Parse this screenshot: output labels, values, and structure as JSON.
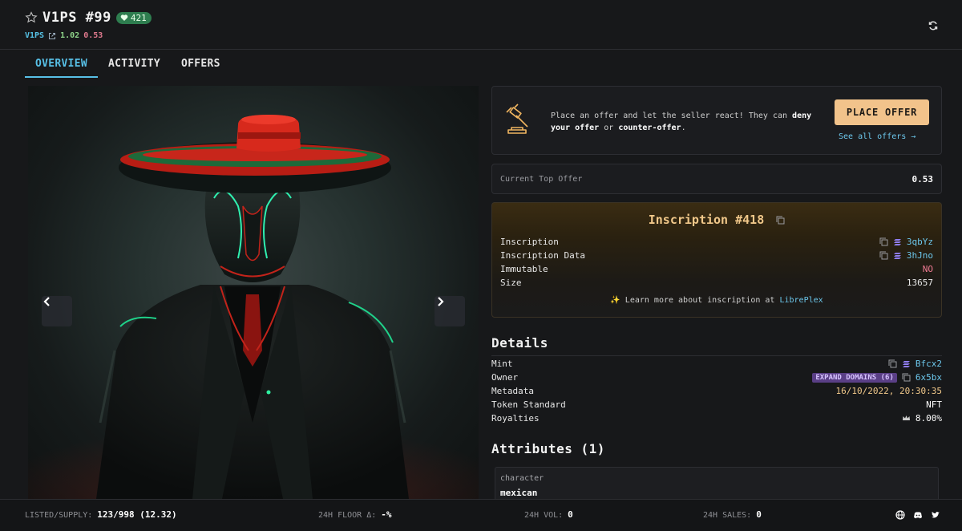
{
  "header": {
    "title": "V1PS #99",
    "likes": "421",
    "collection": "V1PS",
    "price_1": "1.02",
    "price_2": "0.53"
  },
  "tabs": [
    {
      "label": "OVERVIEW",
      "active": true
    },
    {
      "label": "ACTIVITY",
      "active": false
    },
    {
      "label": "OFFERS",
      "active": false
    }
  ],
  "offer": {
    "text_pre": "Place an offer and let the seller react! They can",
    "deny": "deny your offer",
    "or": " or ",
    "counter": "counter-offer",
    "dot": ".",
    "button": "PLACE OFFER",
    "see_all": "See all offers →"
  },
  "top_offer": {
    "label": "Current Top Offer",
    "value": "0.53"
  },
  "inscription": {
    "title": "Inscription #418",
    "rows": [
      {
        "key": "Inscription",
        "value": "3qbYz"
      },
      {
        "key": "Inscription Data",
        "value": "3hJno"
      },
      {
        "key": "Immutable",
        "value": "NO"
      },
      {
        "key": "Size",
        "value": "13657"
      }
    ],
    "learn_pre": "✨ Learn more about inscription at ",
    "learn_link": "LibrePlex"
  },
  "details": {
    "heading": "Details",
    "mint_label": "Mint",
    "mint_value": "Bfcx2",
    "owner_label": "Owner",
    "owner_expand": "EXPAND DOMAINS (6)",
    "owner_value": "6x5bx",
    "metadata_label": "Metadata",
    "metadata_value": "16/10/2022, 20:30:35",
    "standard_label": "Token Standard",
    "standard_value": "NFT",
    "royalties_label": "Royalties",
    "royalties_value": "8.00%"
  },
  "attributes": {
    "heading": "Attributes (1)",
    "items": [
      {
        "trait": "character",
        "value": "mexican"
      }
    ]
  },
  "footer": {
    "listed_label": "LISTED/SUPPLY:",
    "listed_value": "123/998 (12.32)",
    "floor_label": "24H FLOOR Δ:",
    "floor_value": "-%",
    "vol_label": "24H VOL:",
    "vol_value": "0",
    "sales_label": "24H SALES:",
    "sales_value": "0"
  },
  "colors": {
    "accent": "#57bfe6",
    "offer_button": "#f2c38b",
    "badge_green": "#2e7d4f",
    "inscription_gold": "#f1c88a"
  },
  "icons": [
    "star-icon",
    "heart-icon",
    "external-link-icon",
    "refresh-icon",
    "gavel-icon",
    "copy-icon",
    "solana-icon",
    "crown-icon",
    "globe-icon",
    "discord-icon",
    "twitter-icon",
    "chevron-left-icon",
    "chevron-right-icon"
  ]
}
